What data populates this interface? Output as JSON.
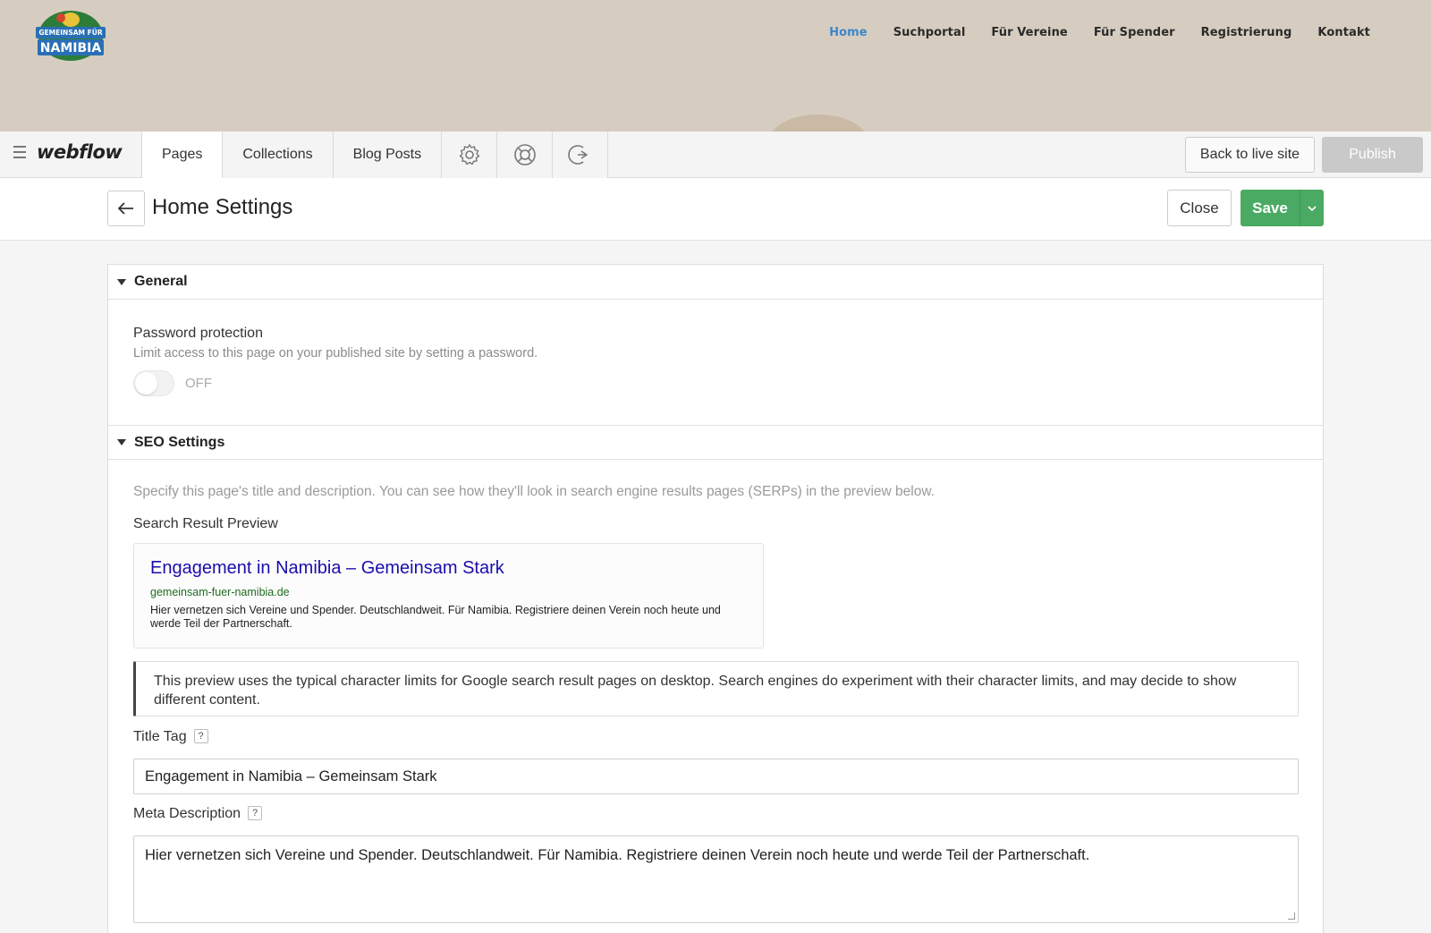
{
  "site": {
    "logo_text_top": "GEMEINSAM FÜR",
    "logo_text_bottom": "NAMIBIA",
    "nav": [
      {
        "label": "Home",
        "active": true
      },
      {
        "label": "Suchportal",
        "active": false
      },
      {
        "label": "Für Vereine",
        "active": false
      },
      {
        "label": "Für Spender",
        "active": false
      },
      {
        "label": "Registrierung",
        "active": false
      },
      {
        "label": "Kontakt",
        "active": false
      }
    ]
  },
  "editor": {
    "brand": "webflow",
    "tabs": [
      {
        "label": "Pages",
        "active": true
      },
      {
        "label": "Collections",
        "active": false
      },
      {
        "label": "Blog Posts",
        "active": false
      }
    ],
    "icon_tabs": [
      "gear-icon",
      "help-icon",
      "logout-icon"
    ],
    "back_to_live_label": "Back to live site",
    "publish_label": "Publish"
  },
  "settings": {
    "title": "Home Settings",
    "close_label": "Close",
    "save_label": "Save",
    "general": {
      "heading": "General",
      "password_label": "Password protection",
      "password_hint": "Limit access to this page on your published site by setting a password.",
      "toggle_state": "OFF"
    },
    "seo": {
      "heading": "SEO Settings",
      "intro": "Specify this page's title and description. You can see how they'll look in search engine results pages (SERPs) in the preview below.",
      "preview_label": "Search Result Preview",
      "preview": {
        "title": "Engagement in Namibia – Gemeinsam Stark",
        "url": "gemeinsam-fuer-namibia.de",
        "description": "Hier vernetzen sich Vereine und Spender. Deutschlandweit. Für Namibia. Registriere deinen Verein noch heute und werde Teil der Partnerschaft."
      },
      "note": "This preview uses the typical character limits for Google search result pages on desktop. Search engines do experiment with their character limits, and may decide to show different content.",
      "title_tag_label": "Title Tag",
      "title_tag_value": "Engagement in Namibia – Gemeinsam Stark",
      "meta_label": "Meta Description",
      "meta_value": "Hier vernetzen sich Vereine und Spender. Deutschlandweit. Für Namibia. Registriere deinen Verein noch heute und werde Teil der Partnerschaft.",
      "help_glyph": "?"
    }
  },
  "colors": {
    "site_header_bg": "#d6cdc0",
    "nav_active": "#3d87c9",
    "save_green": "#4aaa63",
    "serp_title": "#1a0dab",
    "serp_url": "#1e6b1e"
  }
}
